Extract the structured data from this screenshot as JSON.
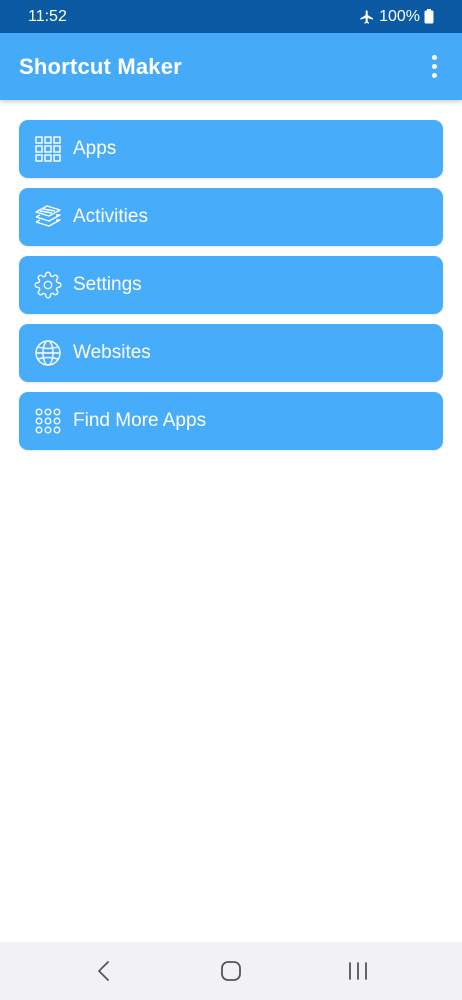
{
  "status_bar": {
    "time": "11:52",
    "battery": "100%",
    "icons": [
      "airplane-mode-icon",
      "battery-icon"
    ]
  },
  "app_bar": {
    "title": "Shortcut Maker",
    "menu_icon": "more-vert-icon"
  },
  "menu": {
    "items": [
      {
        "label": "Apps",
        "icon": "grid-icon"
      },
      {
        "label": "Activities",
        "icon": "layers-icon"
      },
      {
        "label": "Settings",
        "icon": "gear-icon"
      },
      {
        "label": "Websites",
        "icon": "globe-icon"
      },
      {
        "label": "Find More Apps",
        "icon": "dots-grid-icon"
      }
    ]
  },
  "nav_bar": {
    "buttons": [
      "back-icon",
      "home-icon",
      "recents-icon"
    ]
  },
  "colors": {
    "status_bar": "#0b5aa3",
    "app_bar": "#45abf9",
    "menu_item": "#47acfa",
    "nav_bar": "#f2f2f5"
  }
}
